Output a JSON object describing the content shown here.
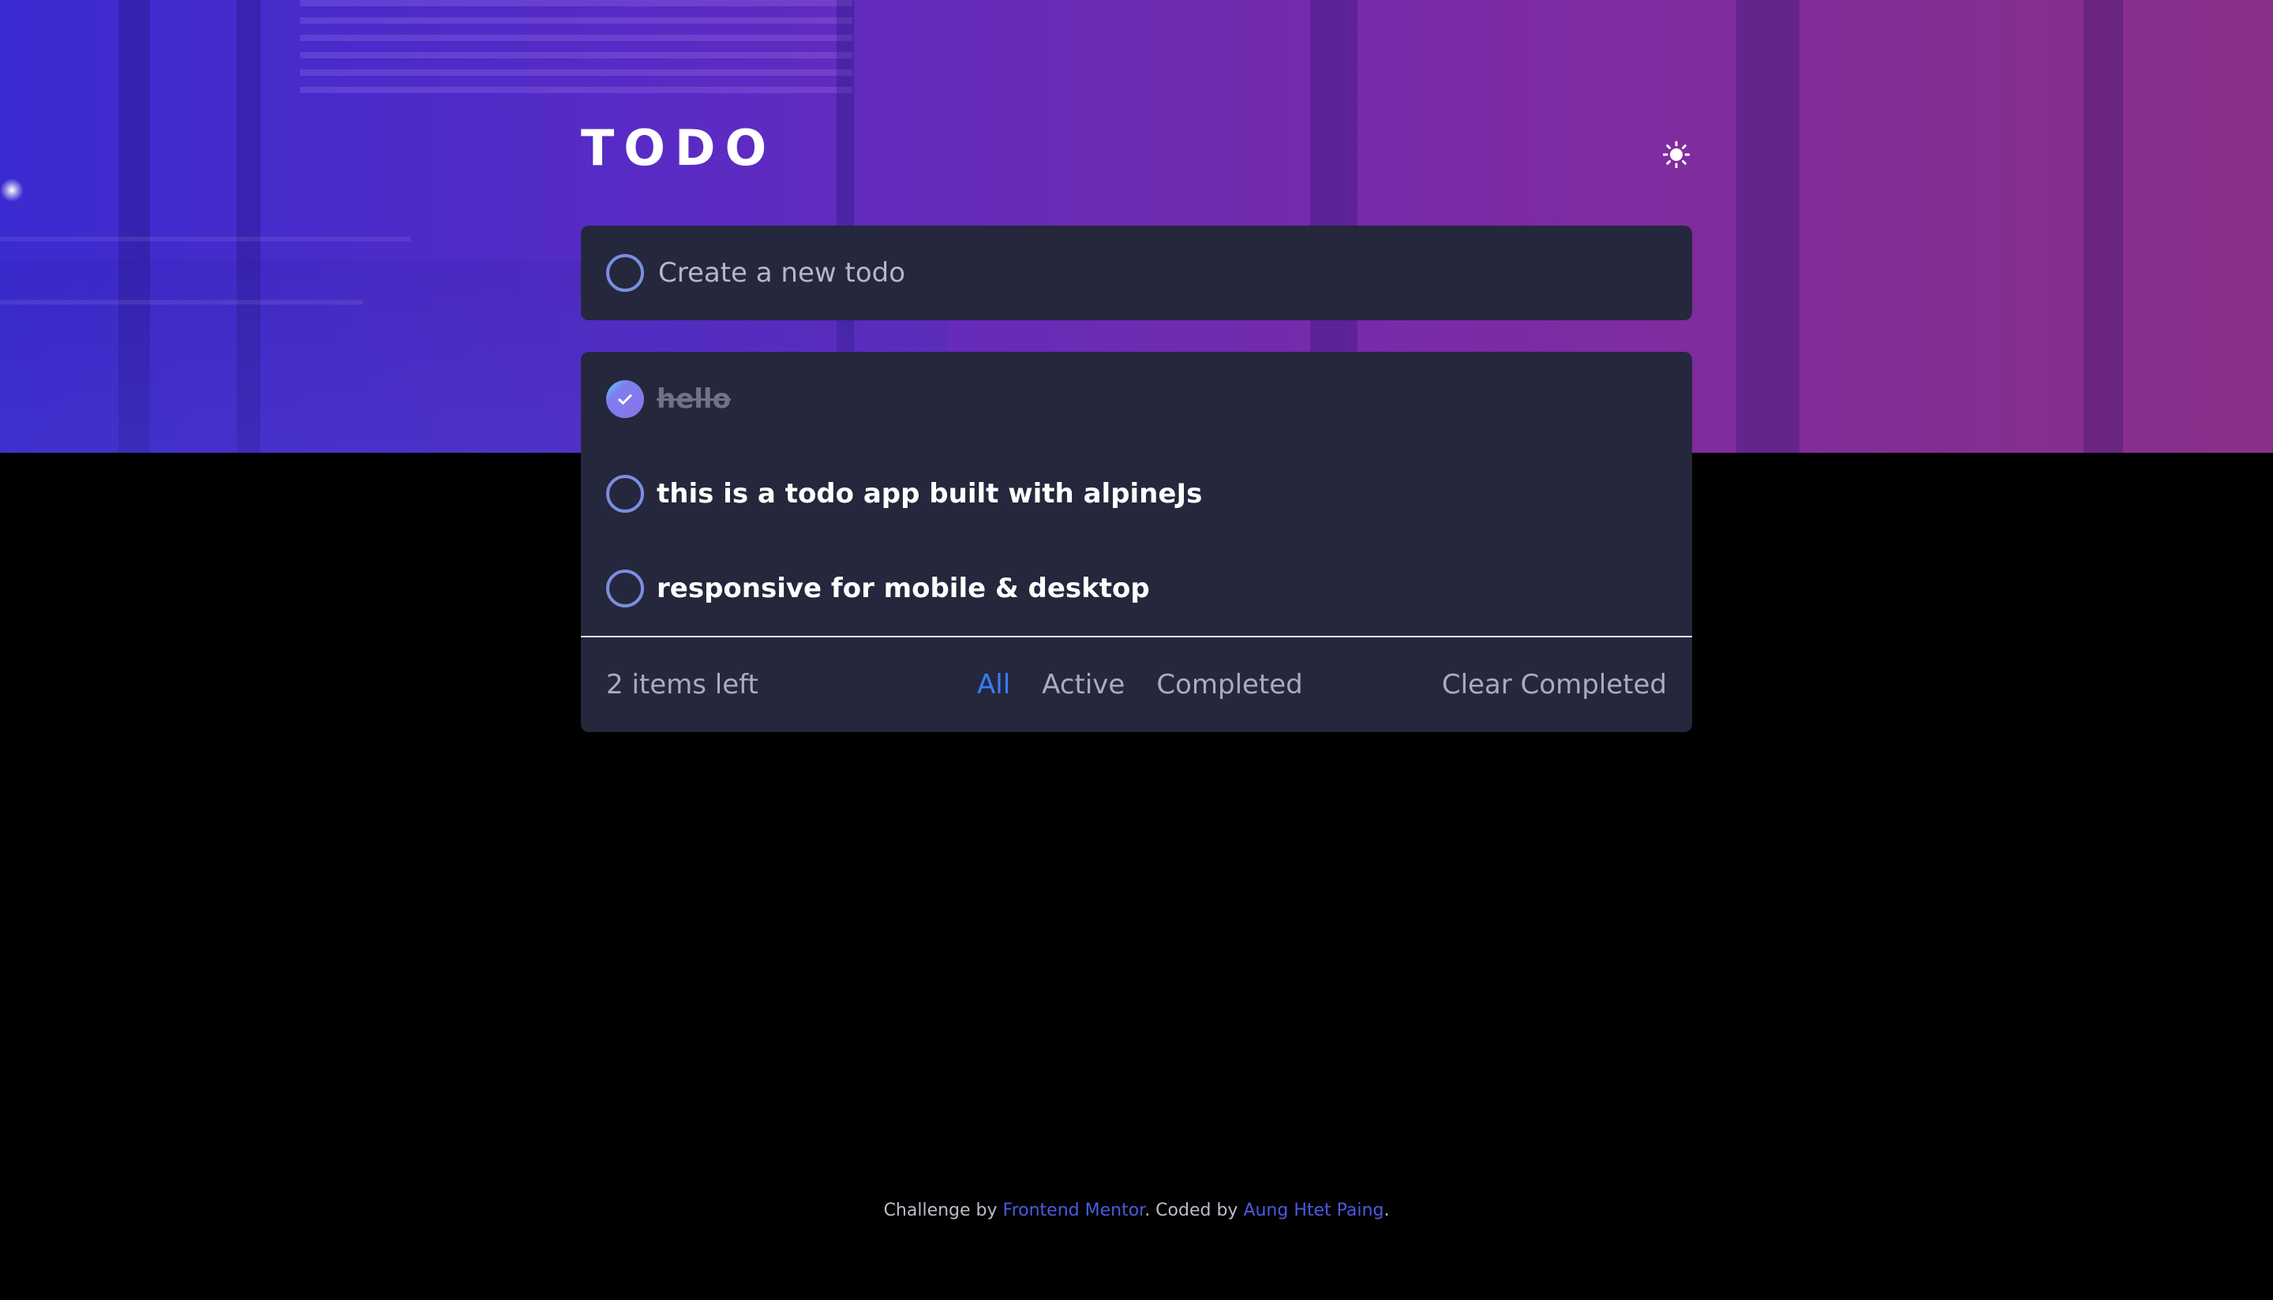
{
  "app": {
    "title": "TODO",
    "theme_toggle_icon": "sun-icon"
  },
  "new_todo": {
    "placeholder": "Create a new todo",
    "value": ""
  },
  "todos": [
    {
      "text": "hello",
      "completed": true
    },
    {
      "text": "this is a todo app built with alpineJs",
      "completed": false
    },
    {
      "text": "responsive for mobile & desktop",
      "completed": false
    }
  ],
  "footer": {
    "items_left": "2 items left",
    "filters": [
      {
        "label": "All",
        "active": true
      },
      {
        "label": "Active",
        "active": false
      },
      {
        "label": "Completed",
        "active": false
      }
    ],
    "clear_label": "Clear Completed"
  },
  "attribution": {
    "prefix": "Challenge by ",
    "mentor_link": "Frontend Mentor",
    "middle": ". Coded by ",
    "author_link": "Aung Htet Paing",
    "suffix": "."
  },
  "colors": {
    "card": "#25273c",
    "accent": "#3a7bfd",
    "check_gradient_start": "#57ddff",
    "check_gradient_end": "#8a74e6"
  }
}
